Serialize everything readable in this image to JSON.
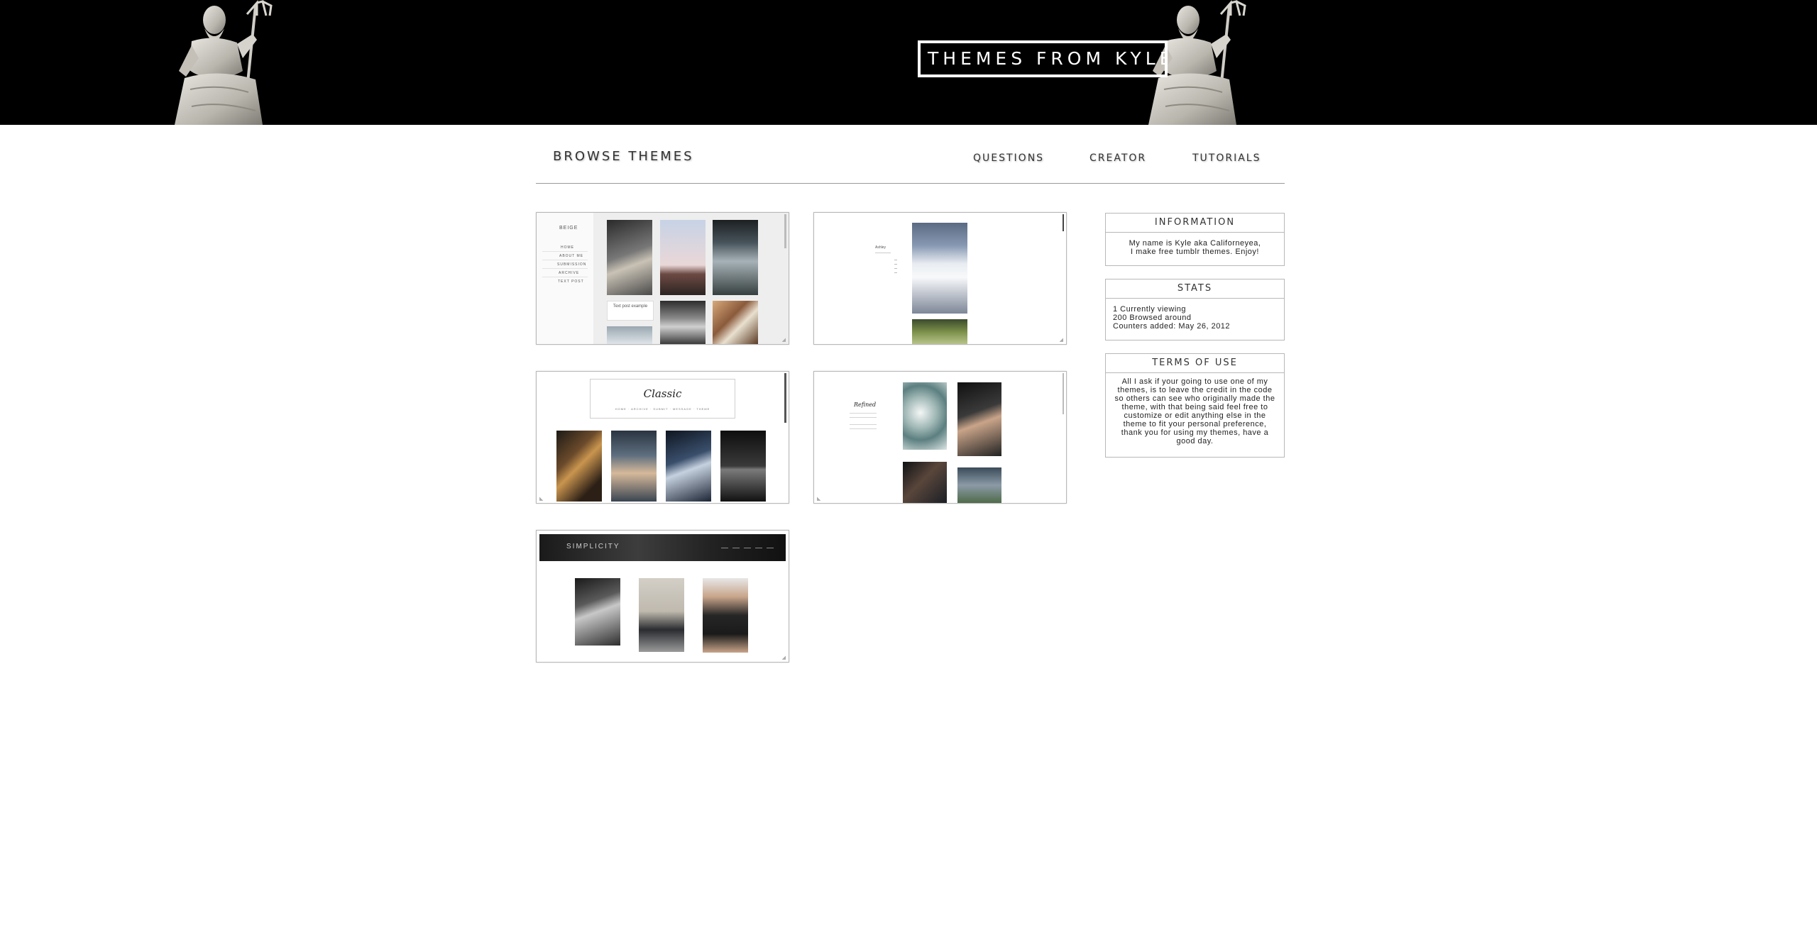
{
  "header": {
    "site_title": "THEMES FROM KYLE"
  },
  "nav": {
    "browse": "BROWSE THEMES",
    "links": [
      "QUESTIONS",
      "CREATOR",
      "TUTORIALS"
    ]
  },
  "themes": [
    {
      "sidebar_title": "BEIGE",
      "menu": [
        "HOME",
        "ABOUT ME",
        "SUBMISSION",
        "ARCHIVE",
        "TEXT POST"
      ],
      "post_text": "Text post example"
    },
    {
      "sidebar_title": "Ashley"
    },
    {
      "header_title": "Classic",
      "menu": "HOME · ARCHIVE · SUBMIT · MESSAGE · THEME"
    },
    {
      "header_title": "Refined"
    },
    {
      "header_title": "SIMPLICITY"
    }
  ],
  "info": {
    "information": {
      "title": "INFORMATION",
      "lines": [
        "My name is Kyle aka Californeyea,",
        "I make free tumblr themes. Enjoy!"
      ]
    },
    "stats": {
      "title": "STATS",
      "lines": [
        "1 Currently viewing",
        "200 Browsed around",
        "Counters added: May 26, 2012"
      ]
    },
    "terms": {
      "title": "TERMS OF USE",
      "text": "All I ask if your going to use one of my themes, is to leave the credit in the code so others can see who originally made the theme, with that being said feel free to customize or edit anything else in the theme to fit your personal preference, thank you for using my themes, have a good day."
    }
  }
}
